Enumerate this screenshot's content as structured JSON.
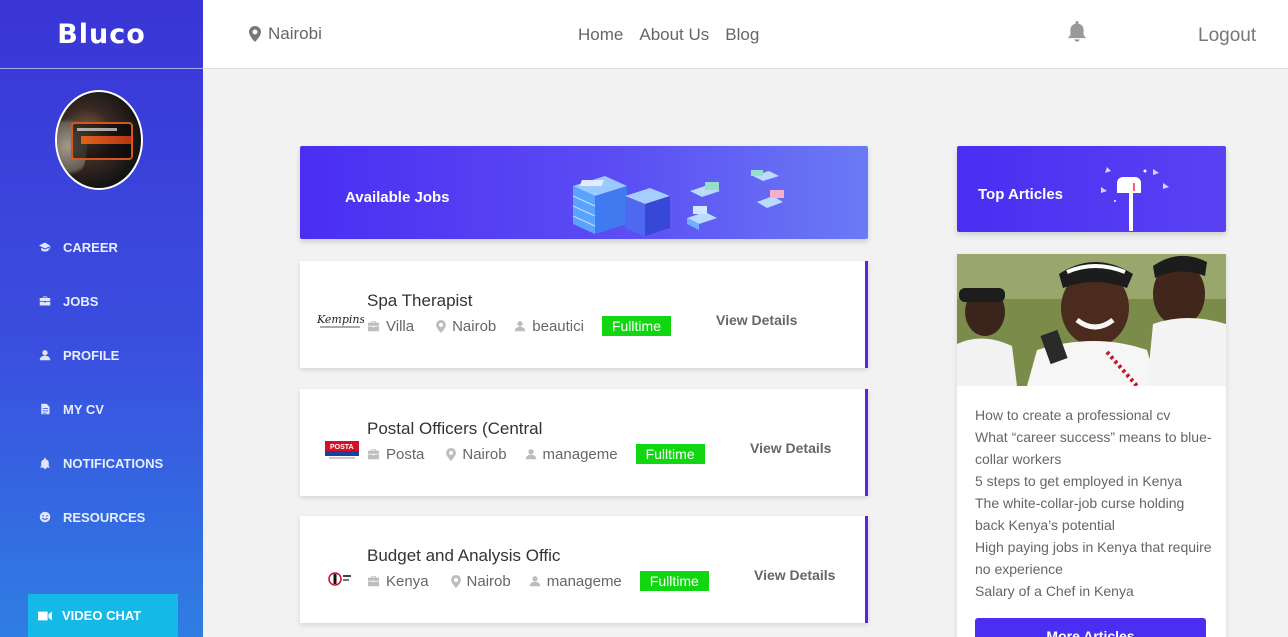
{
  "app": {
    "brand": "Bluco"
  },
  "sidebar": {
    "items": [
      {
        "label": "CAREER",
        "icon": "graduation-cap-icon"
      },
      {
        "label": "JOBS",
        "icon": "briefcase-icon"
      },
      {
        "label": "PROFILE",
        "icon": "user-icon"
      },
      {
        "label": "MY CV",
        "icon": "document-icon"
      },
      {
        "label": "NOTIFICATIONS",
        "icon": "bell-icon"
      },
      {
        "label": "RESOURCES",
        "icon": "smile-icon"
      }
    ],
    "video_chat": {
      "label": "VIDEO CHAT",
      "icon": "video-camera-icon"
    }
  },
  "header": {
    "location": "Nairobi",
    "nav": [
      "Home",
      "About Us",
      "Blog"
    ],
    "logout": "Logout"
  },
  "jobs": {
    "banner_title": "Available Jobs",
    "list": [
      {
        "title": "Spa Therapist",
        "company": "Villa",
        "location": "Nairob",
        "category": "beautici",
        "type": "Fulltime",
        "action": "View Details",
        "logo_text": "Kempinski"
      },
      {
        "title": "Postal Officers (Central",
        "company": "Posta",
        "location": "Nairob",
        "category": "manageme",
        "type": "Fulltime",
        "action": "View Details",
        "logo_text": "POSTA"
      },
      {
        "title": "Budget and Analysis Offic",
        "company": "Kenya",
        "location": "Nairob",
        "category": "manageme",
        "type": "Fulltime",
        "action": "View Details",
        "logo_text": ""
      }
    ]
  },
  "articles": {
    "banner_title": "Top Articles",
    "list": [
      "How to create a professional cv",
      "What “career success” means to blue-collar workers",
      "5 steps to get employed in Kenya",
      "The white-collar-job curse holding back Kenya’s potential",
      "High paying jobs in Kenya that require no experience",
      "Salary of a Chef in Kenya"
    ],
    "more_button": "More Articles"
  },
  "colors": {
    "primary": "#4a2ef2",
    "badge": "#12d612",
    "video_chat": "#14b9e6",
    "card_accent": "#5a24e0"
  }
}
